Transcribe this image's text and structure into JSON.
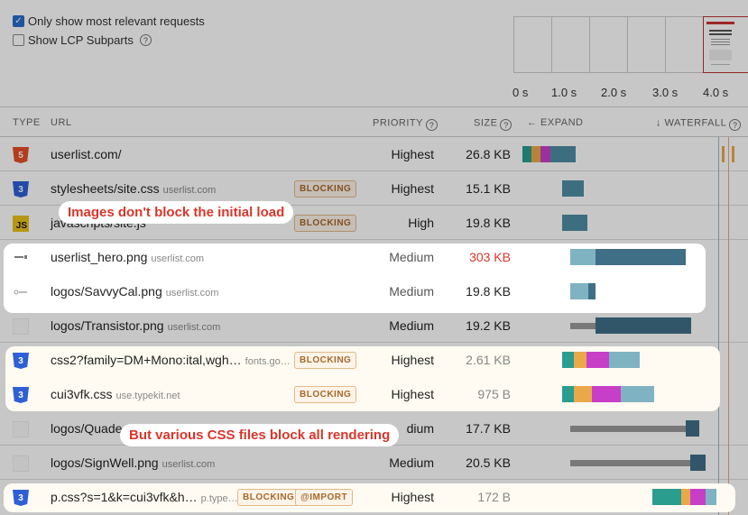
{
  "options": {
    "relevant": "Only show most relevant requests",
    "lcp": "Show LCP Subparts"
  },
  "timeline_ticks": [
    "0 s",
    "1.0 s",
    "2.0 s",
    "3.0 s",
    "4.0 s"
  ],
  "columns": {
    "type": "TYPE",
    "url": "URL",
    "priority": "PRIORITY",
    "size": "SIZE",
    "expand": "← EXPAND",
    "waterfall": "↓ WATERFALL"
  },
  "rows": [
    {
      "type": "html",
      "icon": "html-icon",
      "url": "userlist.com/",
      "domain": "",
      "badges": [],
      "priority": "Highest",
      "size": "26.8 KB"
    },
    {
      "type": "css",
      "icon": "css-icon",
      "url": "stylesheets/site.css",
      "domain": "userlist.com",
      "badges": [
        "BLOCKING"
      ],
      "priority": "Highest",
      "size": "15.1 KB"
    },
    {
      "type": "js",
      "icon": "js-icon",
      "url": "javascripts/site.js",
      "domain": "",
      "badges": [
        "BLOCKING"
      ],
      "priority": "High",
      "size": "19.8 KB"
    },
    {
      "type": "image",
      "icon": "image-thumbnail-icon",
      "url": "userlist_hero.png",
      "domain": "userlist.com",
      "badges": [],
      "priority": "Medium",
      "size": "303 KB"
    },
    {
      "type": "image",
      "icon": "image-thumbnail-icon",
      "url": "logos/SavvyCal.png",
      "domain": "userlist.com",
      "badges": [],
      "priority": "Medium",
      "size": "19.8 KB"
    },
    {
      "type": "image",
      "icon": "image-thumbnail-icon",
      "url": "logos/Transistor.png",
      "domain": "userlist.com",
      "badges": [],
      "priority": "Medium",
      "size": "19.2 KB"
    },
    {
      "type": "css",
      "icon": "css-icon",
      "url": "css2?family=DM+Mono:ital,wgh…",
      "domain": "fonts.go…",
      "badges": [
        "BLOCKING"
      ],
      "priority": "Highest",
      "size": "2.61 KB"
    },
    {
      "type": "css",
      "icon": "css-icon",
      "url": "cui3vfk.css",
      "domain": "use.typekit.net",
      "badges": [
        "BLOCKING"
      ],
      "priority": "Highest",
      "size": "975 B"
    },
    {
      "type": "image",
      "icon": "image-thumbnail-icon",
      "url": "logos/Quade",
      "domain": "",
      "badges": [],
      "priority": "dium",
      "size": "17.7 KB"
    },
    {
      "type": "image",
      "icon": "image-thumbnail-icon",
      "url": "logos/SignWell.png",
      "domain": "userlist.com",
      "badges": [],
      "priority": "Medium",
      "size": "20.5 KB"
    },
    {
      "type": "css",
      "icon": "css-icon",
      "url": "p.css?s=1&k=cui3vfk&h…",
      "domain": "p.type…",
      "badges": [
        "BLOCKING",
        "@IMPORT"
      ],
      "priority": "Highest",
      "size": "172 B"
    }
  ],
  "callouts": {
    "images": "Images don't block the initial load",
    "css": "But various CSS files block all rendering"
  },
  "icon_glyphs": {
    "html": "5",
    "css": "3",
    "js": "JS"
  },
  "colors": {
    "teal": "#2a9d8f",
    "orange": "#e9a94a",
    "magenta": "#c73fc7",
    "light_blue": "#7fb3c2",
    "dark_blue": "#3f6f87",
    "grey_bar": "#9a9a9a",
    "red_text": "#d9362b"
  }
}
